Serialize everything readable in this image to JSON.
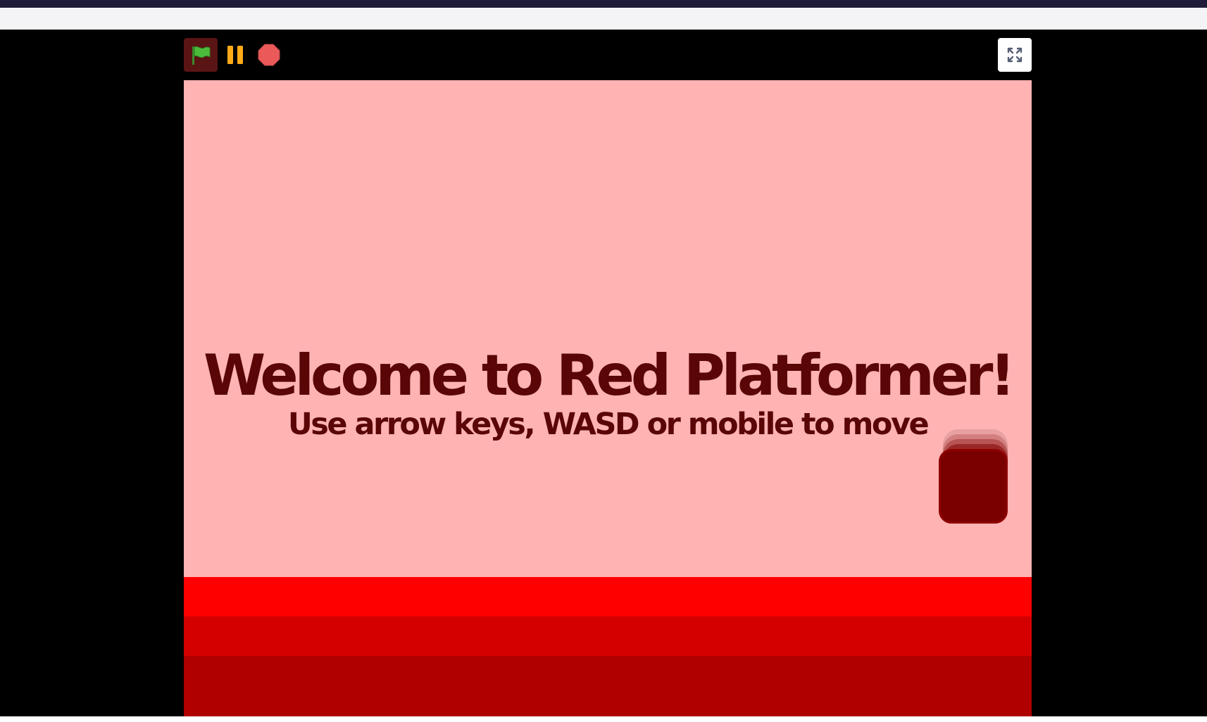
{
  "controls": {
    "green_flag": "green-flag-icon",
    "pause": "pause-icon",
    "stop": "stop-sign-icon",
    "fullscreen": "fullscreen-expand-icon"
  },
  "stage": {
    "title": "Welcome to Red Platformer!",
    "subtitle": "Use arrow keys, WASD or mobile to move"
  },
  "colors": {
    "sky": "#ffb3b3",
    "text": "#5a0606",
    "player": "#7a0000",
    "ground_top": "#ff0000",
    "ground_mid": "#d40000",
    "ground_bottom": "#b00000",
    "flag_green": "#4cbb3c",
    "pause_orange": "#ffab19",
    "stop_red": "#ec5959"
  }
}
